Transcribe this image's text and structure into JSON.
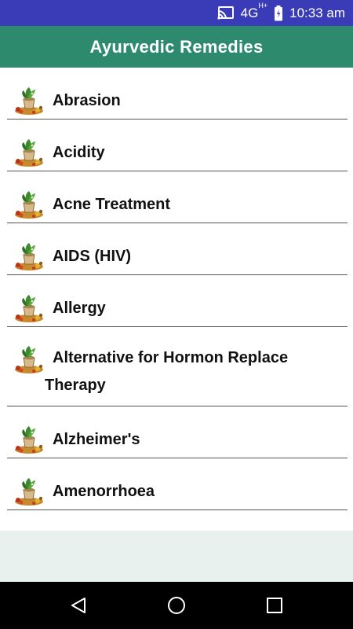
{
  "status_bar": {
    "network": "4G",
    "network_sup": "H+",
    "time": "10:33 am"
  },
  "app_bar": {
    "title": "Ayurvedic Remedies"
  },
  "remedies": [
    "Abrasion",
    "Acidity",
    "Acne Treatment",
    "AIDS (HIV)",
    "Allergy",
    "Alternative for Hormon Replace Therapy",
    "Alzheimer's",
    "Amenorrhoea"
  ],
  "icons": {
    "remedy": "herbs-mortar-icon",
    "nav_back": "back-triangle-icon",
    "nav_home": "home-circle-icon",
    "nav_recents": "recents-square-icon"
  },
  "colors": {
    "status_bar": "#3a3cb7",
    "app_bar": "#2e8a6c",
    "bottom_area": "#e9f1ee",
    "nav_bar": "#000000"
  }
}
